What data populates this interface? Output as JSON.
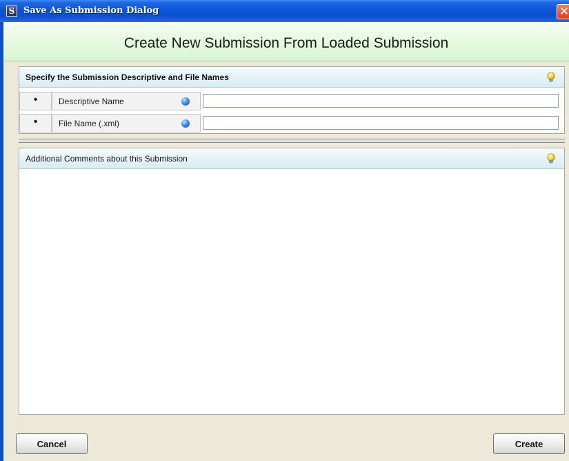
{
  "window": {
    "title": "Save As Submission Dialog",
    "app_icon_letter": "S",
    "close_glyph": "✕"
  },
  "banner": {
    "heading": "Create New Submission From Loaded Submission"
  },
  "names_panel": {
    "title": "Specify the Submission Descriptive and File Names",
    "help_icon": "lightbulb-icon",
    "rows": [
      {
        "bullet": "•",
        "label": "Descriptive Name",
        "required_icon": "blue-dot-icon",
        "value": ""
      },
      {
        "bullet": "•",
        "label": "File Name (.xml)",
        "required_icon": "blue-dot-icon",
        "value": ""
      }
    ]
  },
  "comments_panel": {
    "title": "Additional Comments about this Submission",
    "help_icon": "lightbulb-icon",
    "value": ""
  },
  "footer": {
    "cancel_label": "Cancel",
    "create_label": "Create"
  },
  "colors": {
    "titlebar_blue": "#0a55dc",
    "banner_green": "#d8f5cf",
    "panel_header_blue": "#d8ecf4",
    "dialog_bg": "#ece9d8"
  }
}
